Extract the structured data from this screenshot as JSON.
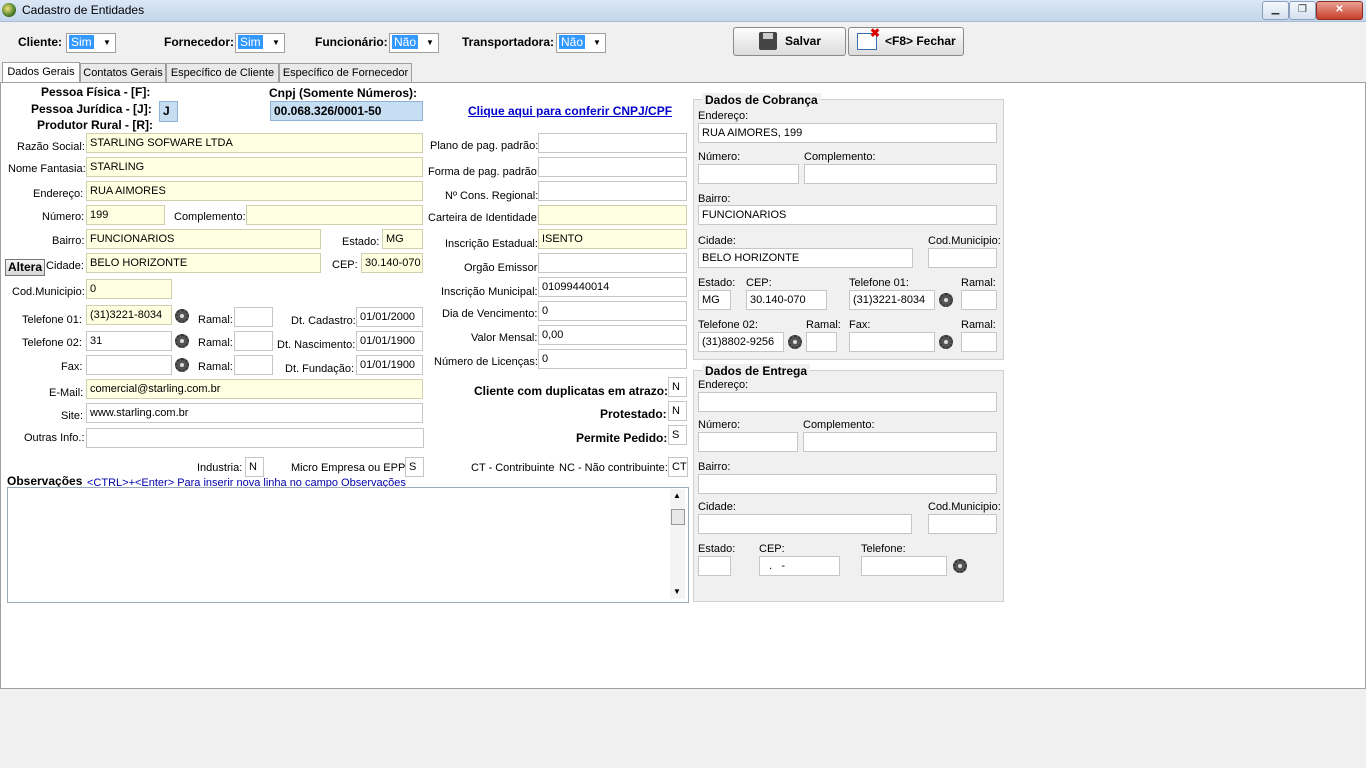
{
  "window": {
    "title": "Cadastro de Entidades",
    "min": "▁",
    "max": "❐",
    "close": "✕"
  },
  "toolbar": {
    "cliente_label": "Cliente:",
    "cliente_value": "Sim",
    "fornecedor_label": "Fornecedor:",
    "fornecedor_value": "Sim",
    "funcionario_label": "Funcionário:",
    "funcionario_value": "Não",
    "transportadora_label": "Transportadora:",
    "transportadora_value": "Não",
    "salvar_label": "Salvar",
    "fechar_label": "<F8> Fechar"
  },
  "tabs": [
    "Dados Gerais",
    "Contatos Gerais",
    "Específico de Cliente",
    "Específico de Fornecedor"
  ],
  "geral": {
    "pessoa_fisica": "Pessoa Física - [F]:",
    "pessoa_juridica": "Pessoa Jurídica - [J]:",
    "produtor_rural": "Produtor Rural - [R]:",
    "tipo_value": "J",
    "cnpj_label": "Cnpj (Somente Números):",
    "cnpj_value": "00.068.326/0001-50",
    "link_cnpj": "Clique aqui para conferir CNPJ/CPF",
    "razao_label": "Razão Social:",
    "razao_value": "STARLING SOFWARE LTDA",
    "fantasia_label": "Nome Fantasia:",
    "fantasia_value": "STARLING",
    "endereco_label": "Endereço:",
    "endereco_value": "RUA AIMORES",
    "numero_label": "Número:",
    "numero_value": "199",
    "complemento_label": "Complemento:",
    "complemento_value": "",
    "bairro_label": "Bairro:",
    "bairro_value": "FUNCIONARIOS",
    "estado_label": "Estado:",
    "estado_value": "MG",
    "altera_label": "Altera",
    "cidade_label": "Cidade:",
    "cidade_value": "BELO HORIZONTE",
    "cep_label": "CEP:",
    "cep_value": "30.140-070",
    "codmun_label": "Cod.Municipio:",
    "codmun_value": "0",
    "tel1_label": "Telefone 01:",
    "tel1_value": "(31)3221-8034",
    "tel2_label": "Telefone 02:",
    "tel2_value": "31",
    "fax_label": "Fax:",
    "fax_value": "",
    "ramal_label": "Ramal:",
    "dtcad_label": "Dt. Cadastro:",
    "dtcad_value": "01/01/2000",
    "dtnasc_label": "Dt. Nascimento:",
    "dtnasc_value": "01/01/1900",
    "dtfund_label": "Dt. Fundação:",
    "dtfund_value": "01/01/1900",
    "email_label": "E-Mail:",
    "email_value": "comercial@starling.com.br",
    "site_label": "Site:",
    "site_value": "www.starling.com.br",
    "outras_label": "Outras Info.:",
    "outras_value": "",
    "industria_label": "Industria:",
    "industria_value": "N",
    "micro_label": "Micro Empresa ou EPP:",
    "micro_value": "S",
    "obs_label": "Observações",
    "obs_hint": "<CTRL>+<Enter> Para inserir nova linha no campo Observações"
  },
  "mid": {
    "plano_label": "Plano de pag. padrão:",
    "plano_value": "",
    "forma_label": "Forma de pag. padrão:",
    "forma_value": "",
    "cons_label": "Nº Cons. Regional:",
    "cons_value": "",
    "identidade_label": "Carteira de Identidade:",
    "identidade_value": "",
    "inscest_label": "Inscrição Estadual:",
    "inscest_value": "ISENTO",
    "orgao_label": "Orgão Emissor:",
    "orgao_value": "",
    "inscmun_label": "Inscrição Municipal:",
    "inscmun_value": "01099440014",
    "venc_label": "Dia de Vencimento:",
    "venc_value": "0",
    "valor_label": "Valor Mensal:",
    "valor_value": "0,00",
    "licencas_label": "Número de Licenças:",
    "licencas_value": "0",
    "duplicatas_label": "Cliente com duplicatas em atrazo:",
    "duplicatas_value": "N",
    "protestado_label": "Protestado:",
    "protestado_value": "N",
    "permite_label": "Permite Pedido:",
    "permite_value": "S",
    "ct_label": "CT - Contribuinte",
    "nc_label": "NC - Não contribuinte:",
    "ct_value": "CT"
  },
  "cobranca": {
    "title": "Dados de Cobrança",
    "endereco_label": "Endereço:",
    "endereco_value": "RUA AIMORES, 199",
    "numero_label": "Número:",
    "numero_value": "",
    "complemento_label": "Complemento:",
    "complemento_value": "",
    "bairro_label": "Bairro:",
    "bairro_value": "FUNCIONARIOS",
    "cidade_label": "Cidade:",
    "cidade_value": "BELO HORIZONTE",
    "codmun_label": "Cod.Municipio:",
    "codmun_value": "",
    "estado_label": "Estado:",
    "estado_value": "MG",
    "cep_label": "CEP:",
    "cep_value": "30.140-070",
    "tel1_label": "Telefone 01:",
    "tel1_value": "(31)3221-8034",
    "ramal_label": "Ramal:",
    "ramal1_value": "",
    "tel2_label": "Telefone 02:",
    "tel2_value": "(31)8802-9256",
    "ramal2_value": "",
    "fax_label": "Fax:",
    "fax_value": "",
    "ramal3_value": ""
  },
  "entrega": {
    "title": "Dados de Entrega",
    "endereco_label": "Endereço:",
    "endereco_value": "",
    "numero_label": "Número:",
    "numero_value": "",
    "complemento_label": "Complemento:",
    "complemento_value": "",
    "bairro_label": "Bairro:",
    "bairro_value": "",
    "cidade_label": "Cidade:",
    "cidade_value": "",
    "codmun_label": "Cod.Municipio:",
    "codmun_value": "",
    "estado_label": "Estado:",
    "estado_value": "",
    "cep_label": "CEP:",
    "cep_value": "  .   -",
    "telefone_label": "Telefone:",
    "telefone_value": ""
  }
}
